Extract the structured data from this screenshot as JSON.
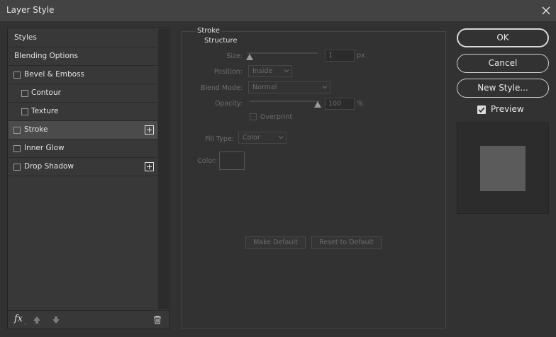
{
  "window": {
    "title": "Layer Style"
  },
  "style_list": {
    "items": [
      {
        "label": "Styles",
        "has_checkbox": false,
        "indent": false,
        "selected": false,
        "has_add": false
      },
      {
        "label": "Blending Options",
        "has_checkbox": false,
        "indent": false,
        "selected": false,
        "has_add": false
      },
      {
        "label": "Bevel & Emboss",
        "has_checkbox": true,
        "checked": false,
        "indent": false,
        "selected": false,
        "has_add": false
      },
      {
        "label": "Contour",
        "has_checkbox": true,
        "checked": false,
        "indent": true,
        "selected": false,
        "has_add": false
      },
      {
        "label": "Texture",
        "has_checkbox": true,
        "checked": false,
        "indent": true,
        "selected": false,
        "has_add": false
      },
      {
        "label": "Stroke",
        "has_checkbox": true,
        "checked": false,
        "indent": false,
        "selected": true,
        "has_add": true
      },
      {
        "label": "Inner Glow",
        "has_checkbox": true,
        "checked": false,
        "indent": false,
        "selected": false,
        "has_add": false
      },
      {
        "label": "Drop Shadow",
        "has_checkbox": true,
        "checked": false,
        "indent": false,
        "selected": false,
        "has_add": true
      }
    ],
    "bottom": {
      "fx_label": "fx",
      "fx_dot": "."
    }
  },
  "stroke": {
    "group_title": "Stroke",
    "structure_title": "Structure",
    "size": {
      "label": "Size:",
      "value": "1",
      "unit": "px"
    },
    "position": {
      "label": "Position:",
      "value": "Inside"
    },
    "blend_mode": {
      "label": "Blend Mode:",
      "value": "Normal"
    },
    "opacity": {
      "label": "Opacity:",
      "value": "100",
      "unit": "%"
    },
    "overprint": {
      "label": "Overprint",
      "checked": false
    },
    "fill_type": {
      "label": "Fill Type:",
      "value": "Color"
    },
    "color": {
      "label": "Color:",
      "swatch": "#303030"
    },
    "make_default_label": "Make Default",
    "reset_default_label": "Reset to Default"
  },
  "actions": {
    "ok_label": "OK",
    "cancel_label": "Cancel",
    "new_style_label": "New Style...",
    "preview_label": "Preview",
    "preview_checked": true,
    "preview_color": "#5b5b5b"
  },
  "icons": {
    "close": "close-icon",
    "arrow_up": "arrow-up-icon",
    "arrow_down": "arrow-down-icon",
    "trash": "trash-icon",
    "plus": "plus-icon",
    "chevron": "chevron-down-icon",
    "check": "check-icon"
  }
}
